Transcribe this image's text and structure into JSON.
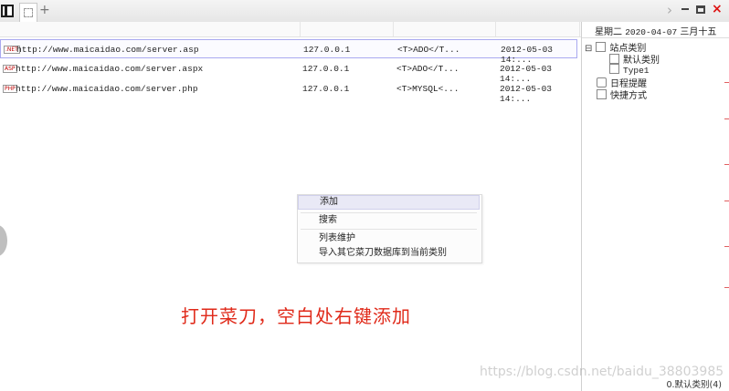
{
  "toolbar": {
    "panel_icon": "panel-toggle-icon",
    "tab_icon": "document-tab-icon",
    "add_tab": "+",
    "nav_right": "›",
    "close": "×"
  },
  "list": {
    "rows": [
      {
        "badge": ".NET",
        "url": "http://www.maicaidao.com/server.asp",
        "ip": "127.0.0.1",
        "type": "<T>ADO</T...",
        "date": "2012-05-03 14:..."
      },
      {
        "badge": "ASP",
        "url": "http://www.maicaidao.com/server.aspx",
        "ip": "127.0.0.1",
        "type": "<T>ADO</T...",
        "date": "2012-05-03 14:..."
      },
      {
        "badge": "PHP",
        "url": "http://www.maicaidao.com/server.php",
        "ip": "127.0.0.1",
        "type": "<T>MYSQL<...",
        "date": "2012-05-03 14:..."
      }
    ]
  },
  "sidebar": {
    "weekday": "星期二",
    "date": "2020-04-07",
    "lunar": "三月十五",
    "tree": {
      "site_category": "站点类别",
      "default_category": "默认类别",
      "type1": "Type1",
      "schedule": "日程提醒",
      "shortcuts": "快捷方式",
      "toggle": "⊟"
    },
    "status": "0.默认类别(4)"
  },
  "context_menu": {
    "add": "添加",
    "search": "搜索",
    "list_maintenance": "列表维护",
    "import": "导入其它菜刀数据库到当前类别"
  },
  "annotation": "打开菜刀，空白处右键添加",
  "watermark": "https://blog.csdn.net/baidu_38803985",
  "colors": {
    "annotation": "#e02a1a",
    "close": "#dd1111",
    "selection_border": "#a9a9f0"
  }
}
